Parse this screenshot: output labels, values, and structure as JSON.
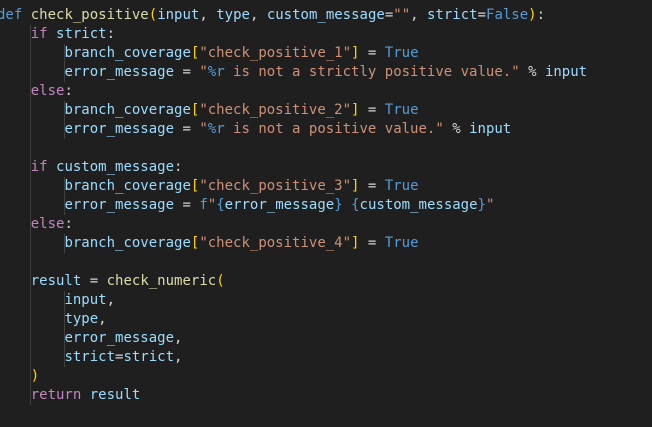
{
  "editor": {
    "language": "python",
    "colors": {
      "background": "#1f1f1f",
      "keyword": "#c586c0",
      "storage": "#569cd6",
      "function": "#dcdcaa",
      "variable": "#9cdcfe",
      "string": "#ce9178",
      "bracket_level1": "#ffd700",
      "bracket_level2": "#da70d6"
    },
    "lines": [
      "def check_positive(input, type, custom_message=\"\", strict=False):",
      "    if strict:",
      "        branch_coverage[\"check_positive_1\"] = True",
      "        error_message = \"%r is not a strictly positive value.\" % input",
      "    else:",
      "        branch_coverage[\"check_positive_2\"] = True",
      "        error_message = \"%r is not a positive value.\" % input",
      "",
      "    if custom_message:",
      "        branch_coverage[\"check_positive_3\"] = True",
      "        error_message = f\"{error_message} {custom_message}\"",
      "    else:",
      "        branch_coverage[\"check_positive_4\"] = True",
      "",
      "    result = check_numeric(",
      "        input,",
      "        type,",
      "        error_message,",
      "        strict=strict,",
      "    )",
      "    return result"
    ]
  }
}
